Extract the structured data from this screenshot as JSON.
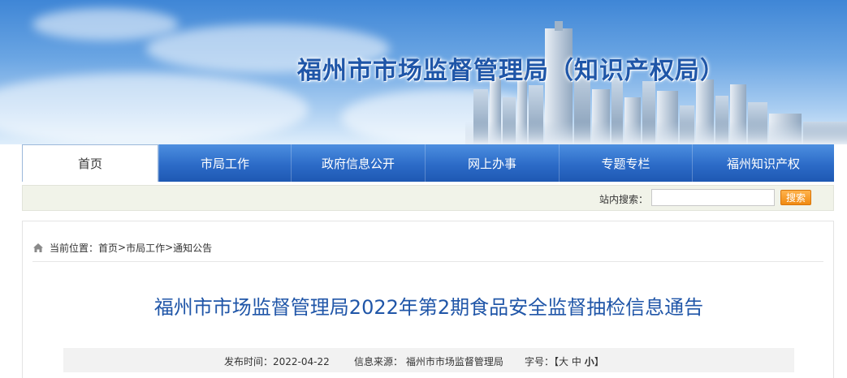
{
  "banner": {
    "title": "福州市市场监督管理局（知识产权局）"
  },
  "nav": {
    "items": [
      {
        "label": "首页",
        "active": true
      },
      {
        "label": "市局工作",
        "active": false
      },
      {
        "label": "政府信息公开",
        "active": false
      },
      {
        "label": "网上办事",
        "active": false
      },
      {
        "label": "专题专栏",
        "active": false
      },
      {
        "label": "福州知识产权",
        "active": false
      }
    ]
  },
  "search": {
    "label": "站内搜索：",
    "value": "",
    "placeholder": "",
    "button_label": "搜索"
  },
  "breadcrumb": {
    "prefix": "当前位置：",
    "items": [
      "首页",
      "市局工作",
      "通知公告"
    ],
    "separator": ">"
  },
  "article": {
    "title": "福州市市场监督管理局2022年第2期食品安全监督抽检信息通告",
    "publish_label": "发布时间：",
    "publish_date": "2022-04-22",
    "source_label": "信息来源：",
    "source": "福州市市场监督管理局",
    "fontsize_label": "字号：",
    "fontsize_open": "【",
    "fontsize_options": [
      "大",
      "中",
      "小"
    ],
    "fontsize_close": "】"
  },
  "colors": {
    "nav_blue": "#2c6bc7",
    "title_blue": "#2056a8",
    "search_button": "#f08a12"
  }
}
